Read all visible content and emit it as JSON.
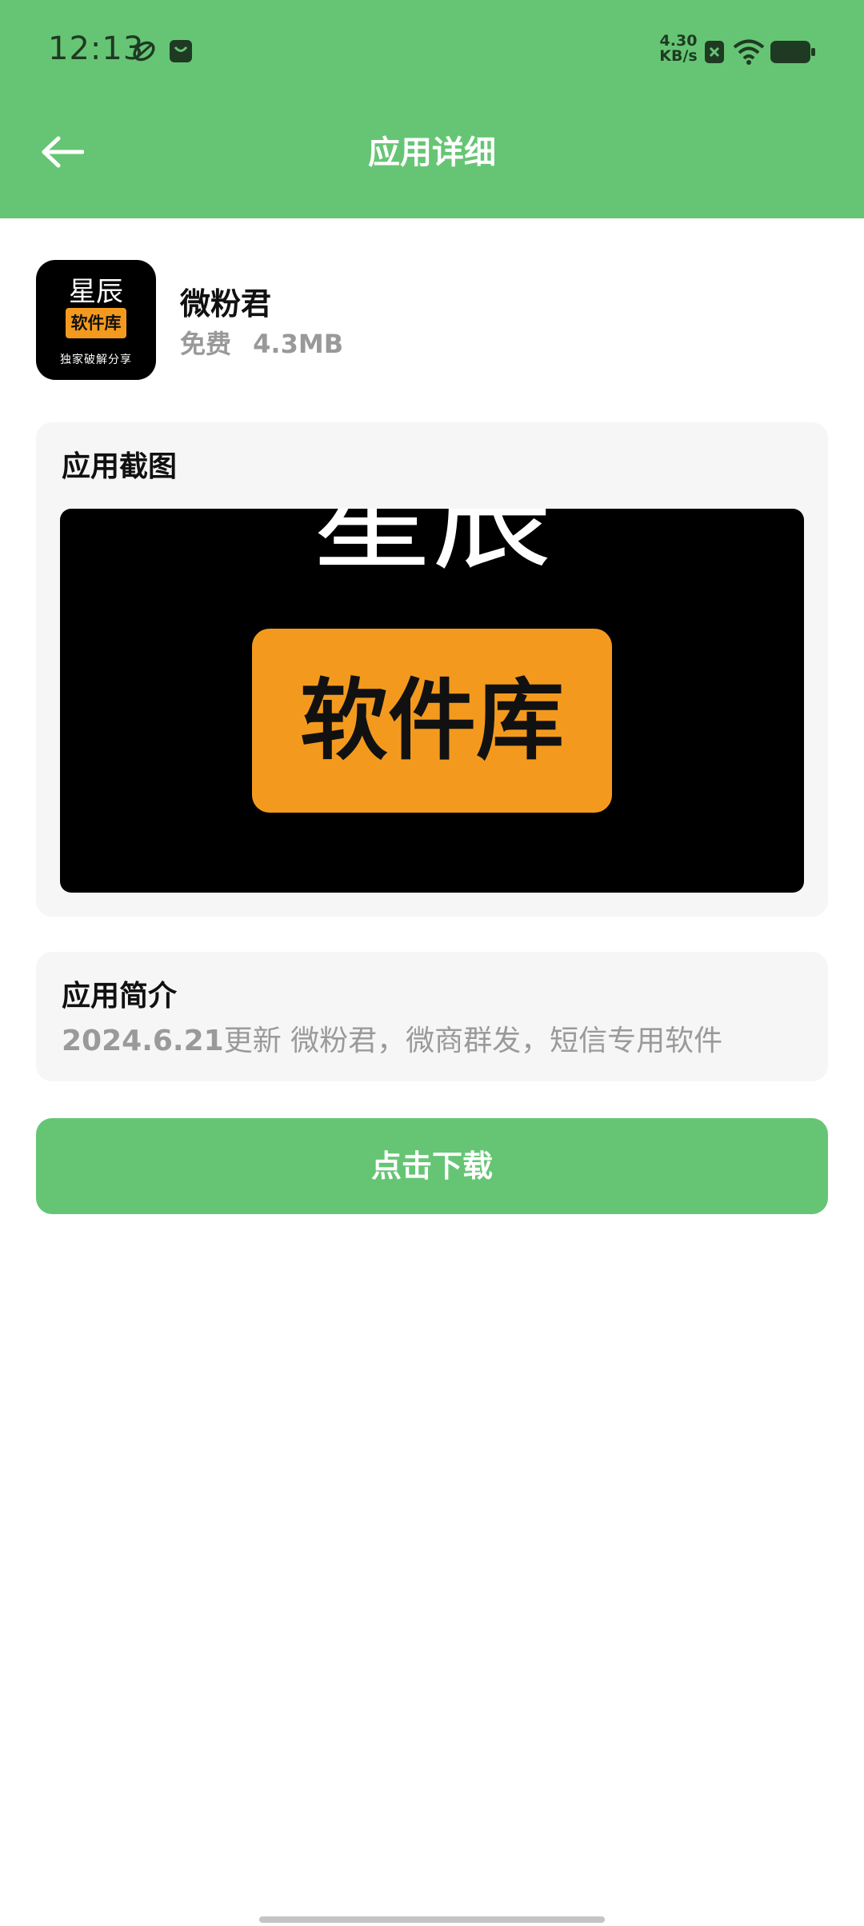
{
  "status_bar": {
    "time": "12:13",
    "net_speed_value": "4.30",
    "net_speed_unit": "KB/s",
    "icons": [
      "leaf-icon",
      "mail-icon",
      "sim-icon",
      "wifi-icon",
      "battery-icon"
    ]
  },
  "header": {
    "title": "应用详细",
    "back_icon": "arrow-left-icon",
    "color": "#66c574"
  },
  "app": {
    "name": "微粉君",
    "price": "免费",
    "size": "4.3MB",
    "icon_text_top": "星辰",
    "icon_text_badge": "软件库",
    "icon_text_bottom": "独家破解分享"
  },
  "screenshots": {
    "title": "应用截图",
    "image_text_top": "星辰",
    "image_text_badge": "软件库"
  },
  "intro": {
    "title": "应用简介",
    "version": "2024.6.21",
    "text": "更新 微粉君，微商群发，短信专用软件"
  },
  "download": {
    "label": "点击下载"
  },
  "colors": {
    "accent": "#66c574",
    "badge_orange": "#f39a1e",
    "muted_text": "#999999"
  }
}
